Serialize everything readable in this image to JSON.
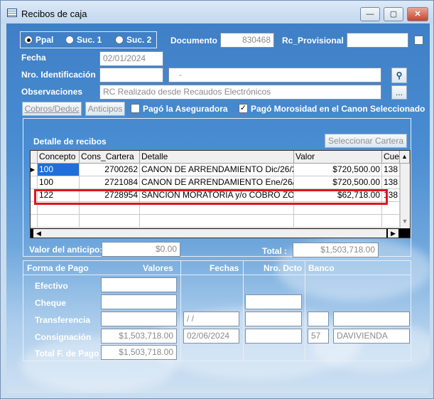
{
  "window": {
    "title": "Recibos de caja",
    "minimize": "—",
    "maximize": "▢",
    "close": "✕"
  },
  "branch": {
    "options": [
      "Ppal",
      "Suc. 1",
      "Suc. 2"
    ],
    "selected": "Ppal"
  },
  "documento": {
    "label": "Documento",
    "value": "830468"
  },
  "provisional": {
    "label": "Rc_Provisional",
    "value": "",
    "checked": false
  },
  "fecha": {
    "label": "Fecha",
    "value": "02/01/2024"
  },
  "identificacion": {
    "label": "Nro. Identificación",
    "value": "",
    "name": "-"
  },
  "observaciones": {
    "label": "Observaciones",
    "value": "RC Realizado desde Recaudos Electrónicos",
    "more": "..."
  },
  "buttons": {
    "cobros": "Cobros/Deduc",
    "anticipos": "Anticipos",
    "seleccionar": "Seleccionar Cartera"
  },
  "checks": {
    "aseguradora": {
      "label": "Pagó la Aseguradora",
      "checked": false
    },
    "morosidad": {
      "label": "Pagó Morosidad en el Canon Seleccionado",
      "checked": true
    }
  },
  "detalle": {
    "title": "Detalle de recibos",
    "columns": [
      "Concepto",
      "Cons_Cartera",
      "Detalle",
      "Valor",
      "Cue"
    ],
    "rows": [
      {
        "concepto": "100",
        "cons": "2700262",
        "detalle": "CANON DE ARRENDAMIENTO Dic/26/2",
        "valor": "$720,500.00",
        "cue": "138"
      },
      {
        "concepto": "100",
        "cons": "2721084",
        "detalle": "CANON DE ARRENDAMIENTO Ene/26/",
        "valor": "$720,500.00",
        "cue": "138"
      },
      {
        "concepto": "122",
        "cons": "2728954",
        "detalle": "SANCION MORATORIA y/o COBRO ZON",
        "valor": "$62,718.00",
        "cue": "138"
      }
    ]
  },
  "anticipo": {
    "label": "Valor del anticipo:",
    "value": "$0.00"
  },
  "total": {
    "label": "Total :",
    "value": "$1,503,718.00"
  },
  "pago": {
    "headers": {
      "forma": "Forma de Pago",
      "valores": "Valores",
      "fechas": "Fechas",
      "nro": "Nro. Dcto",
      "banco": "Banco"
    },
    "efectivo": {
      "label": "Efectivo",
      "valor": ""
    },
    "cheque": {
      "label": "Cheque",
      "valor": "",
      "nro": ""
    },
    "transferencia": {
      "label": "Transferencia",
      "valor": "",
      "fecha": " / /",
      "nro": "",
      "banco_cod": "",
      "banco": ""
    },
    "consignacion": {
      "label": "Consignación",
      "valor": "$1,503,718.00",
      "fecha": "02/06/2024",
      "nro": "",
      "banco_cod": "57",
      "banco": "DAVIVIENDA"
    },
    "total": {
      "label": "Total F. de Pago",
      "valor": "$1,503,718.00"
    }
  },
  "colors": {
    "accent": "#1e6fd9",
    "highlight": "#e0141e",
    "background": "#4a8dd2"
  }
}
